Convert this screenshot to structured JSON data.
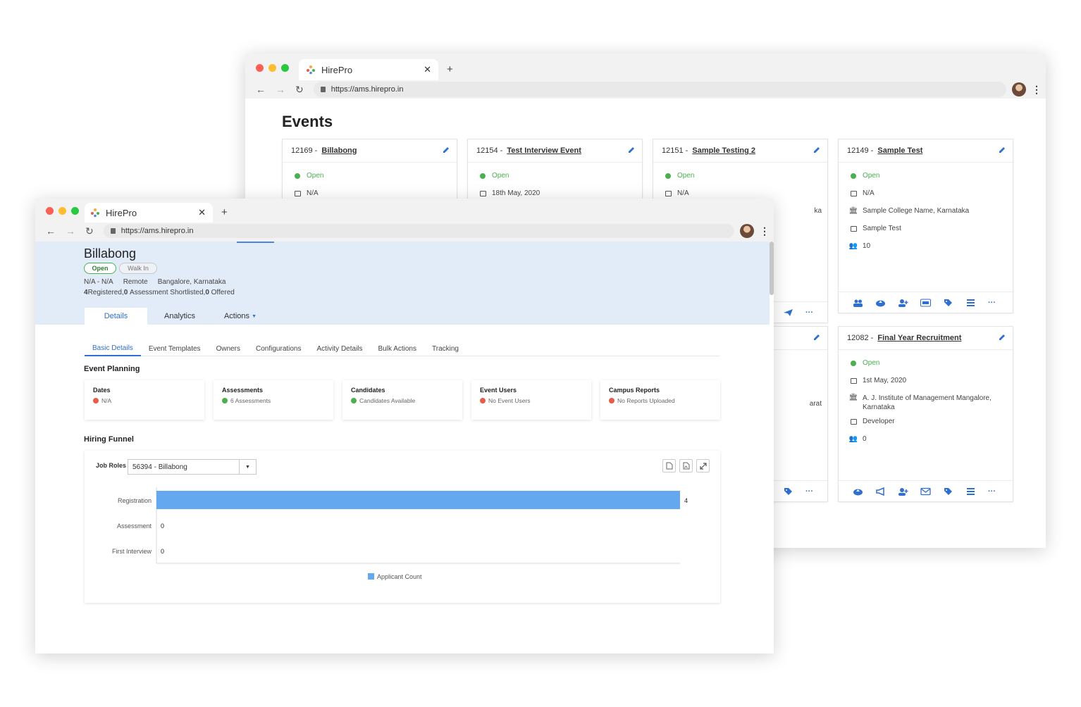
{
  "back_window": {
    "tab_title": "HirePro",
    "url": "https://ams.hirepro.in",
    "page_title": "Events",
    "cards": [
      {
        "id": "12169",
        "name": "Billabong",
        "status": "Open",
        "date": "N/A"
      },
      {
        "id": "12154",
        "name": "Test Interview Event",
        "status": "Open",
        "date": "18th May, 2020"
      },
      {
        "id": "12151",
        "name": "Sample Testing 2",
        "status": "Open",
        "date": "N/A",
        "partial_college": "ka"
      },
      {
        "id": "12149",
        "name": "Sample Test",
        "status": "Open",
        "date": "N/A",
        "college": "Sample College Name, Karnataka",
        "role": "Sample Test",
        "count": "10"
      },
      {
        "id": "12082",
        "name": "Final Year Recruitment",
        "status": "Open",
        "date": "1st May, 2020",
        "college": "A. J. Institute of Management Mangalore, Karnataka",
        "role": "Developer",
        "count": "0"
      }
    ],
    "partial_card_text": "arat"
  },
  "front_window": {
    "tab_title": "HirePro",
    "url": "https://ams.hirepro.in",
    "event": {
      "name": "Billabong",
      "status_badge": "Open",
      "type_badge": "Walk In",
      "dates": "N/A - N/A",
      "mode": "Remote",
      "location": "Bangalore, Karnataka",
      "registered_count": "4",
      "registered_label": "Registered,",
      "shortlisted_count": "0",
      "shortlisted_label": "Assessment Shortlisted,",
      "offered_count": "0",
      "offered_label": "Offered"
    },
    "main_tabs": [
      "Details",
      "Analytics",
      "Actions"
    ],
    "sub_tabs": [
      "Basic Details",
      "Event Templates",
      "Owners",
      "Configurations",
      "Activity Details",
      "Bulk Actions",
      "Tracking"
    ],
    "event_planning": {
      "title": "Event Planning",
      "cards": [
        {
          "title": "Dates",
          "status": "N/A",
          "ok": false
        },
        {
          "title": "Assessments",
          "status": "6 Assessments",
          "ok": true
        },
        {
          "title": "Candidates",
          "status": "Candidates Available",
          "ok": true
        },
        {
          "title": "Event Users",
          "status": "No Event Users",
          "ok": false
        },
        {
          "title": "Campus Reports",
          "status": "No Reports Uploaded",
          "ok": false
        }
      ]
    },
    "hiring_funnel": {
      "title": "Hiring Funnel",
      "job_roles_label": "Job Roles",
      "job_role_selected": "56394 - Billabong"
    }
  },
  "chart_data": {
    "type": "bar",
    "orientation": "horizontal",
    "categories": [
      "Registration",
      "Assessment",
      "First Interview"
    ],
    "series": [
      {
        "name": "Applicant Count",
        "values": [
          4,
          0,
          0
        ]
      }
    ],
    "xlim": [
      0,
      4
    ],
    "grid": false,
    "legend": "bottom-center",
    "color": "#64a8f0"
  }
}
